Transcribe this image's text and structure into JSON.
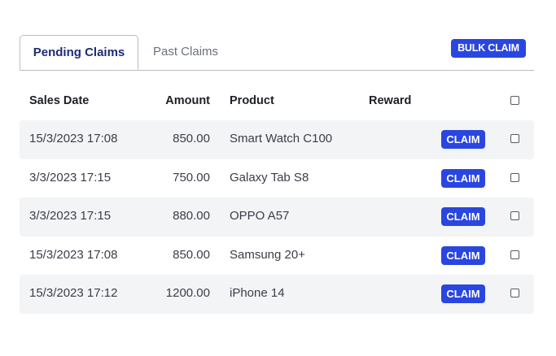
{
  "tabs": [
    {
      "label": "Pending Claims",
      "active": true
    },
    {
      "label": "Past Claims",
      "active": false
    }
  ],
  "bulk_claim_label": "BULK CLAIM",
  "table": {
    "headers": {
      "sales_date": "Sales Date",
      "amount": "Amount",
      "product": "Product",
      "reward": "Reward"
    },
    "claim_label": "CLAIM",
    "rows": [
      {
        "date": "15/3/2023 17:08",
        "amount": "850.00",
        "product": "Smart Watch C100",
        "reward": ""
      },
      {
        "date": "3/3/2023 17:15",
        "amount": "750.00",
        "product": "Galaxy Tab S8",
        "reward": ""
      },
      {
        "date": "3/3/2023 17:15",
        "amount": "880.00",
        "product": "OPPO A57",
        "reward": ""
      },
      {
        "date": "15/3/2023 17:08",
        "amount": "850.00",
        "product": "Samsung 20+",
        "reward": ""
      },
      {
        "date": "15/3/2023 17:12",
        "amount": "1200.00",
        "product": "iPhone 14",
        "reward": ""
      }
    ]
  },
  "colors": {
    "accent": "#2a46e0",
    "active_tab_text": "#1f2a78",
    "row_shade": "#f3f4f6"
  }
}
